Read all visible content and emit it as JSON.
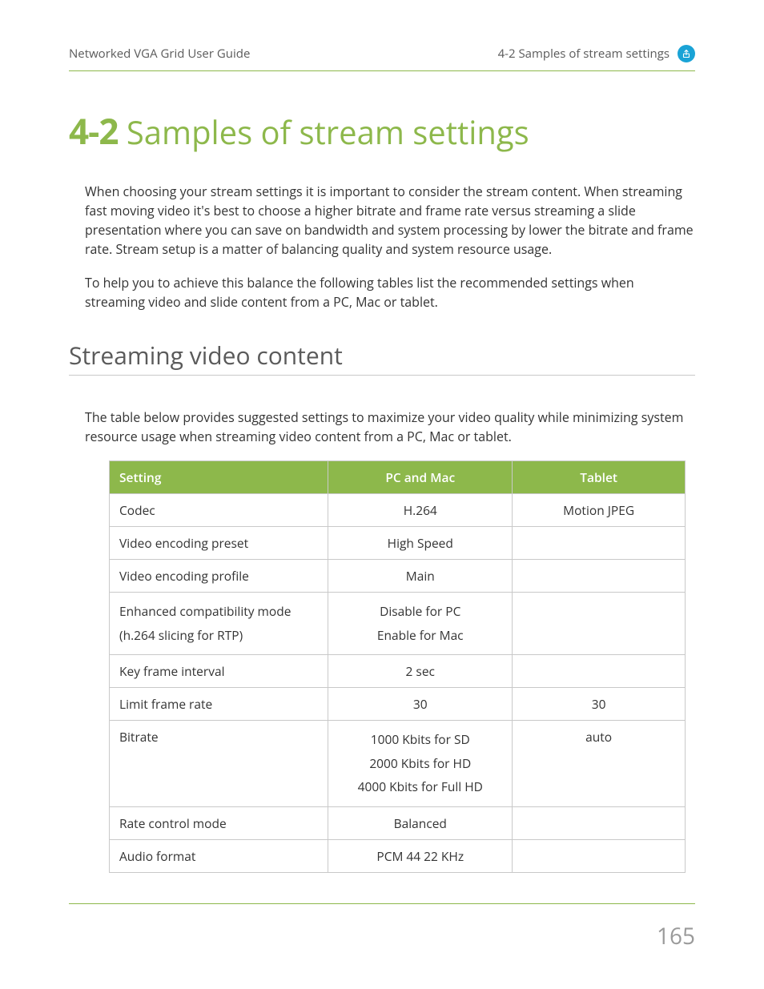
{
  "header": {
    "left": "Networked VGA Grid User Guide",
    "right": "4-2 Samples of stream settings"
  },
  "title": {
    "num": "4-2",
    "text": "Samples of stream settings"
  },
  "intro": {
    "p1": "When choosing your stream settings it is important to consider the stream content. When streaming fast moving video it's best to choose a higher bitrate and frame rate versus streaming a slide presentation where you can save on bandwidth and system processing by lower the bitrate and frame rate. Stream setup is a matter of balancing quality and system resource usage.",
    "p2": "To help you to achieve this balance the following tables list the recommended settings when streaming video and slide content from a PC, Mac or tablet."
  },
  "section": {
    "heading": "Streaming video content",
    "lead": "The table below provides suggested settings to maximize your video quality while minimizing system resource usage when streaming video content from a PC, Mac or tablet."
  },
  "table": {
    "headers": {
      "c1": "Setting",
      "c2": "PC and Mac",
      "c3": "Tablet"
    },
    "rows": {
      "r0": {
        "c1": "Codec",
        "c2": "H.264",
        "c3": "Motion JPEG"
      },
      "r1": {
        "c1": "Video encoding preset",
        "c2": "High Speed",
        "c3": ""
      },
      "r2": {
        "c1": "Video encoding profile",
        "c2": "Main",
        "c3": ""
      },
      "r3": {
        "c1a": "Enhanced compatibility mode",
        "c1b": "(h.264 slicing for RTP)",
        "c2a": "Disable for PC",
        "c2b": "Enable for Mac",
        "c3": ""
      },
      "r4": {
        "c1": "Key frame interval",
        "c2": "2 sec",
        "c3": ""
      },
      "r5": {
        "c1": "Limit frame rate",
        "c2": "30",
        "c3": "30"
      },
      "r6": {
        "c1": "Bitrate",
        "c2a": "1000 Kbits for SD",
        "c2b": "2000 Kbits for HD",
        "c2c": "4000 Kbits for Full HD",
        "c3": "auto"
      },
      "r7": {
        "c1": "Rate control mode",
        "c2": "Balanced",
        "c3": ""
      },
      "r8": {
        "c1": "Audio format",
        "c2": "PCM 44 22 KHz",
        "c3": ""
      }
    }
  },
  "page_number": "165"
}
